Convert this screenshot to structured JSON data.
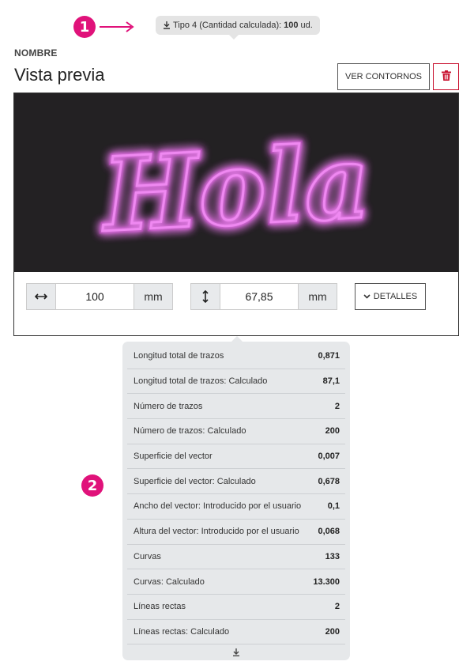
{
  "annotations": {
    "badge1": "1",
    "badge2": "2"
  },
  "tooltip": {
    "text": "Tipo 4 (Cantidad calculada):",
    "value": "100",
    "unit": "ud."
  },
  "header": {
    "label": "NOMBRE",
    "title": "Vista previa"
  },
  "buttons": {
    "contornos": "VER CONTORNOS",
    "detalles": "DETALLES"
  },
  "preview": {
    "text": "Hola",
    "glow_color": "#e23ce6",
    "background": "#232123"
  },
  "dimensions": {
    "width": {
      "value": "100",
      "unit": "mm"
    },
    "height": {
      "value": "67,85",
      "unit": "mm"
    }
  },
  "details": [
    {
      "label": "Longitud total de trazos",
      "value": "0,871"
    },
    {
      "label": "Longitud total de trazos: Calculado",
      "value": "87,1"
    },
    {
      "label": "Número de trazos",
      "value": "2"
    },
    {
      "label": "Número de trazos: Calculado",
      "value": "200"
    },
    {
      "label": "Superficie del vector",
      "value": "0,007"
    },
    {
      "label": "Superficie del vector: Calculado",
      "value": "0,678"
    },
    {
      "label": "Ancho del vector: Introducido por el usuario",
      "value": "0,1"
    },
    {
      "label": "Altura del vector: Introducido por el usuario",
      "value": "0,068"
    },
    {
      "label": "Curvas",
      "value": "133"
    },
    {
      "label": "Curvas: Calculado",
      "value": "13.300"
    },
    {
      "label": "Líneas rectas",
      "value": "2"
    },
    {
      "label": "Líneas rectas: Calculado",
      "value": "200"
    }
  ],
  "colors": {
    "accent": "#e0127a",
    "danger": "#c8102e",
    "panel": "#e6e8ea"
  },
  "icons": {
    "tooltip": "download-icon",
    "delete": "trash-icon",
    "width": "horizontal-arrows-icon",
    "height": "vertical-arrows-icon",
    "detalles": "chevron-down-icon",
    "footer": "expand-down-icon"
  }
}
